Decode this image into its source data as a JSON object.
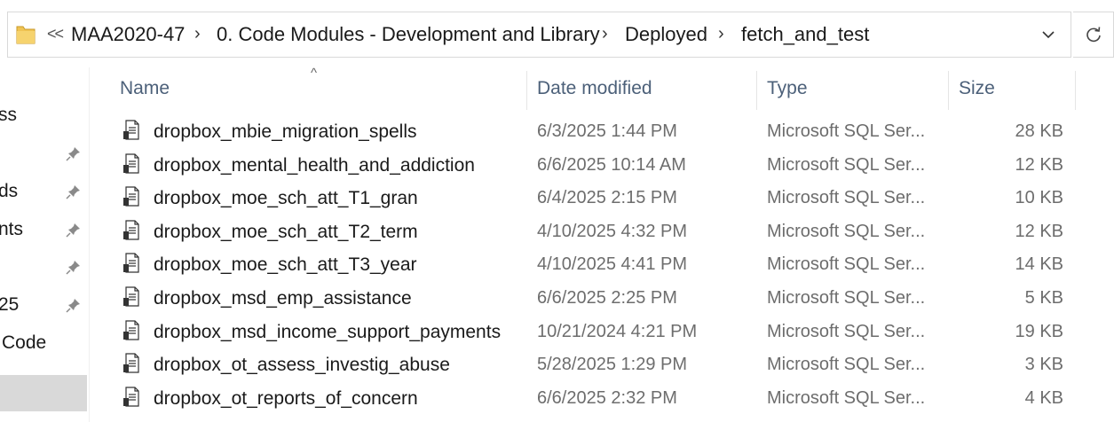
{
  "address_bar": {
    "overflow_label": "<<",
    "crumbs": [
      "MAA2020-47",
      "0. Code Modules - Development and Library",
      "Deployed",
      "fetch_and_test"
    ]
  },
  "nav_pane": {
    "items": [
      {
        "label": "ss",
        "pinned": false
      },
      {
        "label": "",
        "pinned": true
      },
      {
        "label": "ds",
        "pinned": true
      },
      {
        "label": "nts",
        "pinned": true
      },
      {
        "label": "",
        "pinned": true
      },
      {
        "label": "25",
        "pinned": true
      },
      {
        "label": "Code",
        "pinned": false
      }
    ]
  },
  "columns": {
    "name": "Name",
    "date": "Date modified",
    "type": "Type",
    "size": "Size"
  },
  "files": [
    {
      "name": "dropbox_mbie_migration_spells",
      "date": "6/3/2025 1:44 PM",
      "type": "Microsoft SQL Ser...",
      "size": "28 KB"
    },
    {
      "name": "dropbox_mental_health_and_addiction",
      "date": "6/6/2025 10:14 AM",
      "type": "Microsoft SQL Ser...",
      "size": "12 KB"
    },
    {
      "name": "dropbox_moe_sch_att_T1_gran",
      "date": "6/4/2025 2:15 PM",
      "type": "Microsoft SQL Ser...",
      "size": "10 KB"
    },
    {
      "name": "dropbox_moe_sch_att_T2_term",
      "date": "4/10/2025 4:32 PM",
      "type": "Microsoft SQL Ser...",
      "size": "12 KB"
    },
    {
      "name": "dropbox_moe_sch_att_T3_year",
      "date": "4/10/2025 4:41 PM",
      "type": "Microsoft SQL Ser...",
      "size": "14 KB"
    },
    {
      "name": "dropbox_msd_emp_assistance",
      "date": "6/6/2025 2:25 PM",
      "type": "Microsoft SQL Ser...",
      "size": "5 KB"
    },
    {
      "name": "dropbox_msd_income_support_payments",
      "date": "10/21/2024 4:21 PM",
      "type": "Microsoft SQL Ser...",
      "size": "19 KB"
    },
    {
      "name": "dropbox_ot_assess_investig_abuse",
      "date": "5/28/2025 1:29 PM",
      "type": "Microsoft SQL Ser...",
      "size": "3 KB"
    },
    {
      "name": "dropbox_ot_reports_of_concern",
      "date": "6/6/2025 2:32 PM",
      "type": "Microsoft SQL Ser...",
      "size": "4 KB"
    }
  ],
  "colors": {
    "header_text": "#4c6079",
    "folder": "#f0c454",
    "secondary_text": "#6d6d6d"
  }
}
